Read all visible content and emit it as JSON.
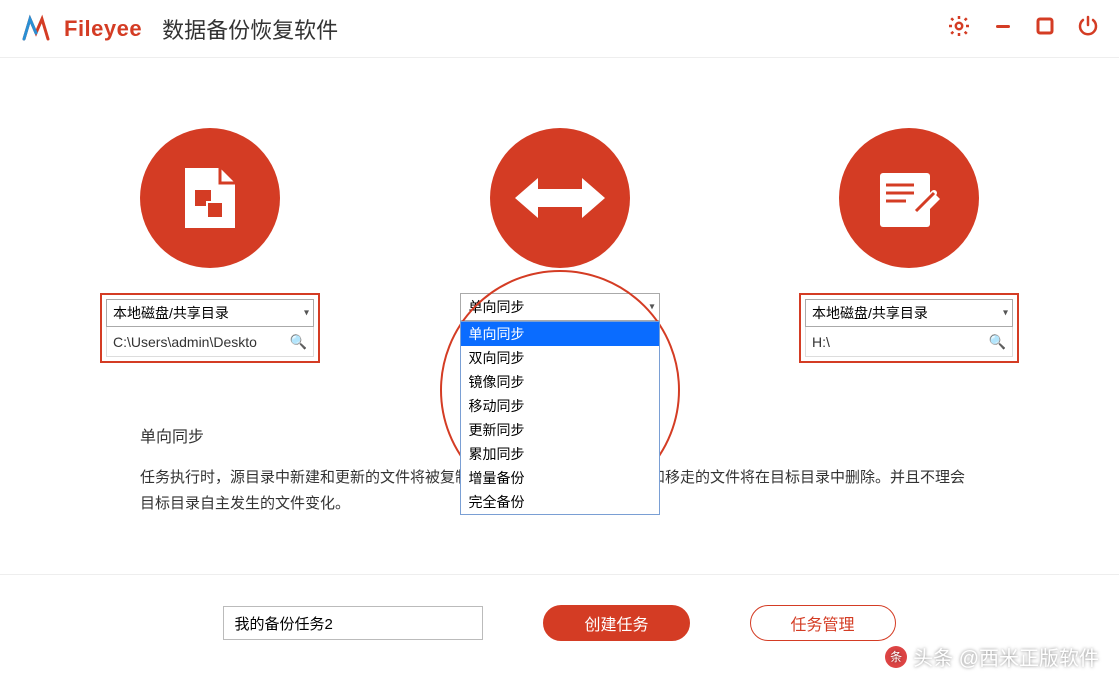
{
  "header": {
    "app_name": "Fileyee",
    "app_subtitle": "数据备份恢复软件"
  },
  "source": {
    "type_label": "本地磁盘/共享目录",
    "path": "C:\\Users\\admin\\Deskto"
  },
  "sync": {
    "current": "单向同步",
    "options": [
      "单向同步",
      "双向同步",
      "镜像同步",
      "移动同步",
      "更新同步",
      "累加同步",
      "增量备份",
      "完全备份"
    ],
    "selected_index": 0
  },
  "target": {
    "type_label": "本地磁盘/共享目录",
    "path": "H:\\"
  },
  "description": {
    "title": "单向同步",
    "text": "任务执行时，源目录中新建和更新的文件将被复制到目标目录，源目录中删除和移走的文件将在目标目录中删除。并且不理会目标目录自主发生的文件变化。"
  },
  "footer": {
    "task_name": "我的备份任务2",
    "create_label": "创建任务",
    "manage_label": "任务管理"
  },
  "watermark": "头条 @西米正版软件"
}
